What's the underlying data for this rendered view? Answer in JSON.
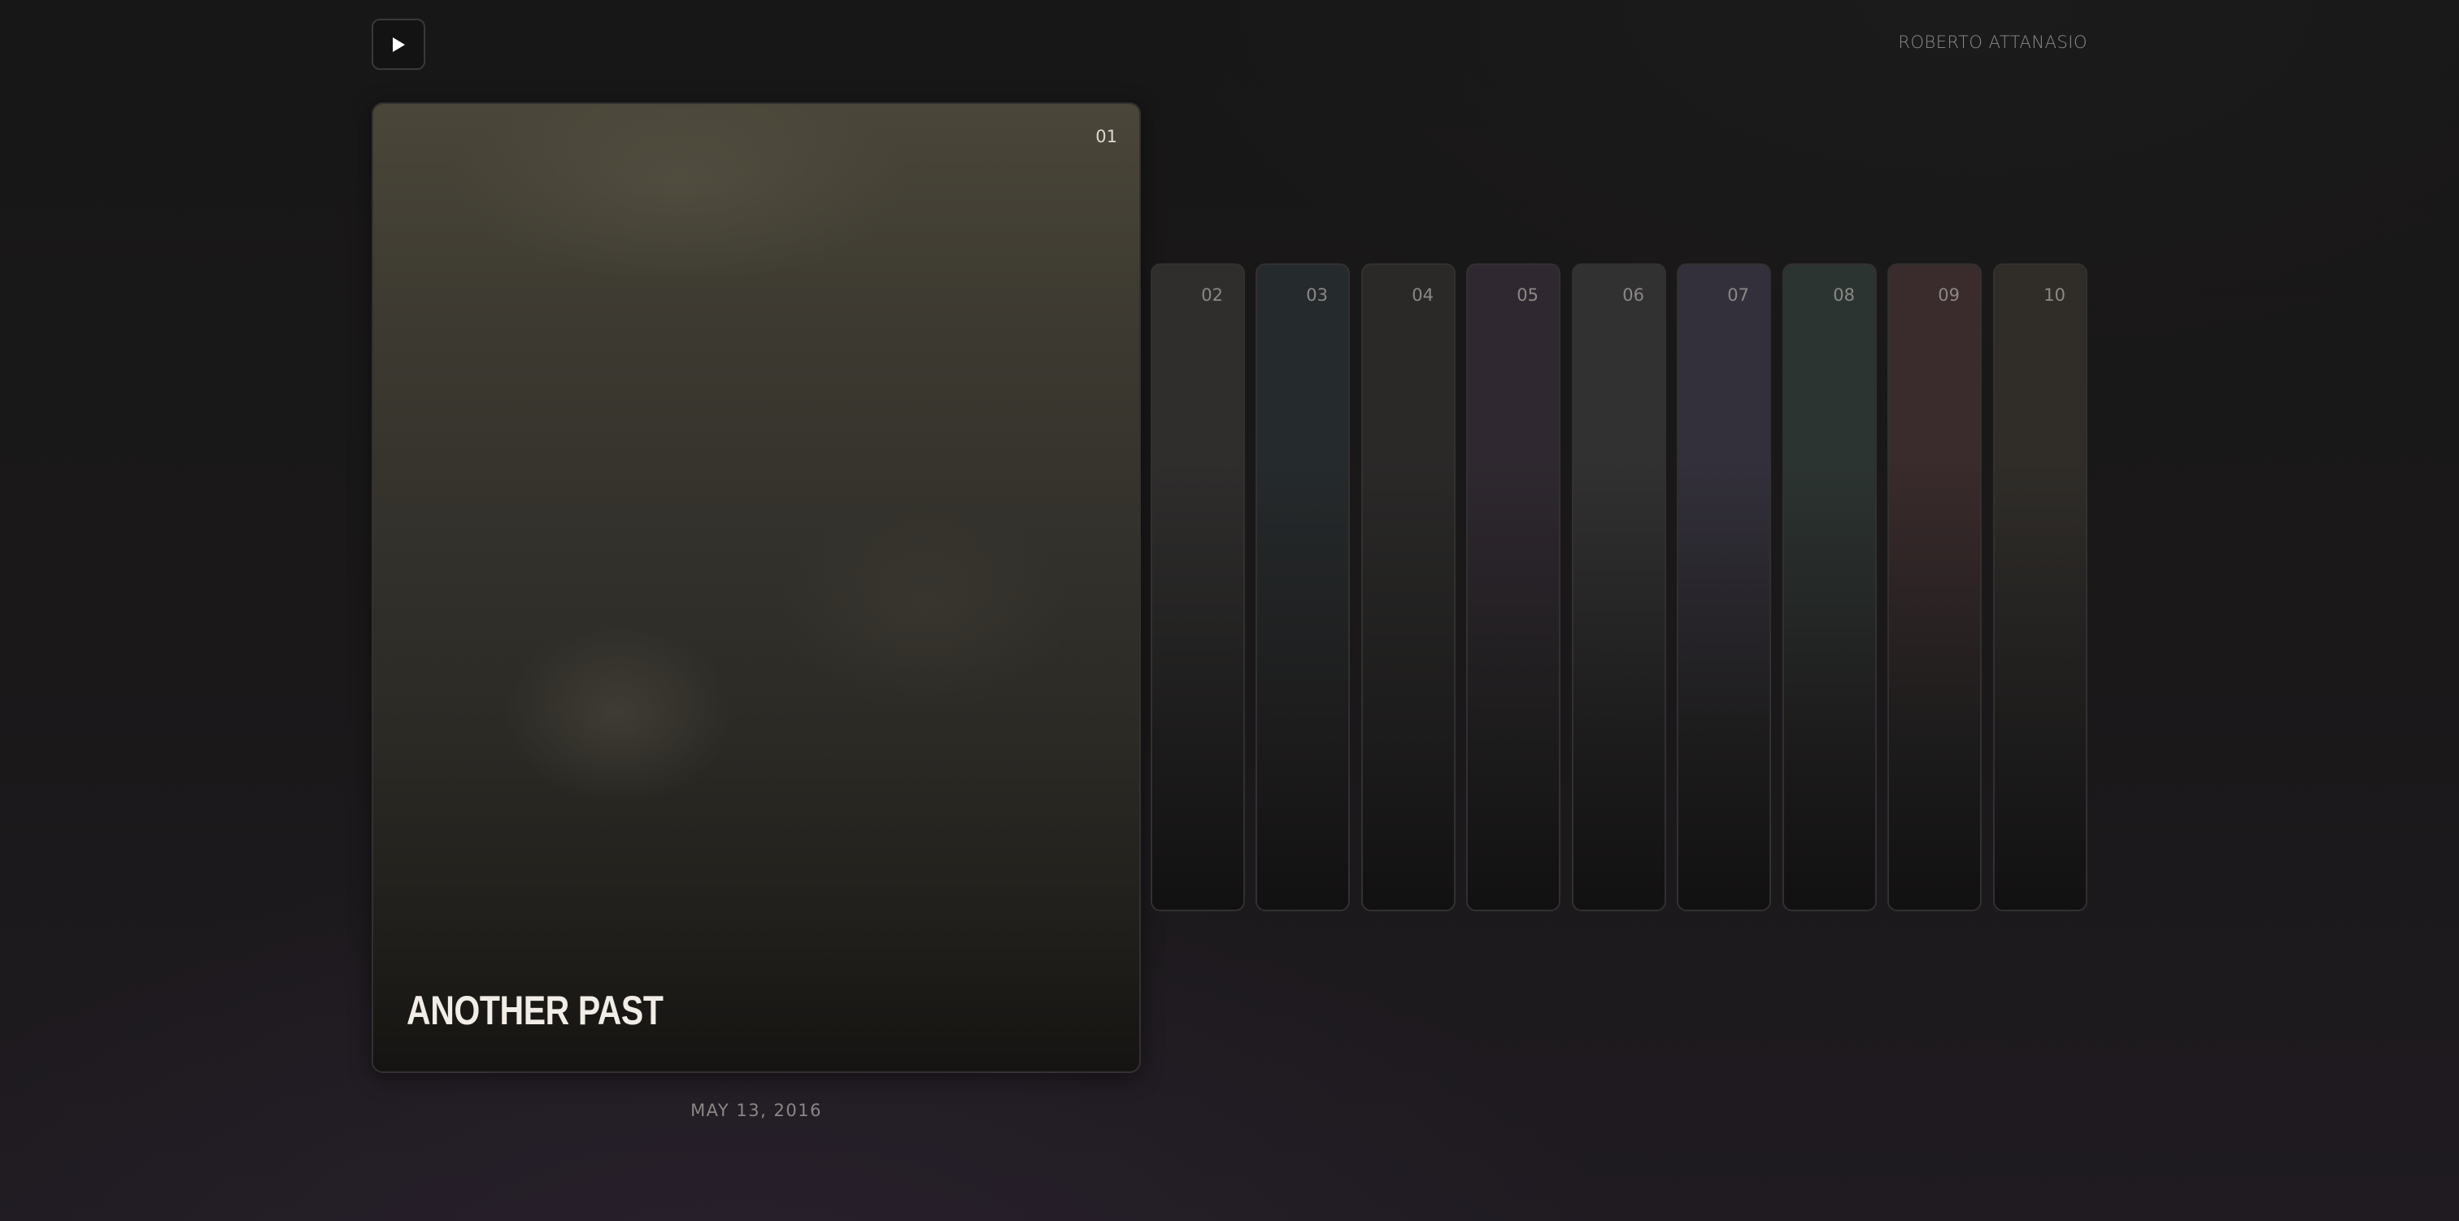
{
  "header": {
    "play_icon": "play-icon",
    "author": "ROBERTO ATTANASIO"
  },
  "featured": {
    "number": "01",
    "title": "ANOTHER PAST",
    "date": "MAY 13, 2016"
  },
  "thumbnails": [
    {
      "number": "02",
      "tint": "#2f2e2d"
    },
    {
      "number": "03",
      "tint": "#252a2c"
    },
    {
      "number": "04",
      "tint": "#2a2928"
    },
    {
      "number": "05",
      "tint": "#2f2830"
    },
    {
      "number": "06",
      "tint": "#323131"
    },
    {
      "number": "07",
      "tint": "#33303b"
    },
    {
      "number": "08",
      "tint": "#2c3431"
    },
    {
      "number": "09",
      "tint": "#3a2b2c"
    },
    {
      "number": "10",
      "tint": "#302d29"
    }
  ]
}
